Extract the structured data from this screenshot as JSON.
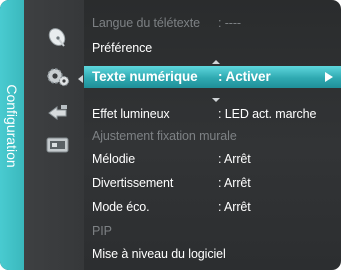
{
  "sidebar": {
    "tab_label": "Configuration"
  },
  "categories": [
    {
      "icon": "satellite-dish-icon"
    },
    {
      "icon": "gears-icon"
    },
    {
      "icon": "input-arrow-icon"
    },
    {
      "icon": "application-icon"
    }
  ],
  "menu": {
    "items": [
      {
        "label": "Langue du télétexte",
        "value": ": ----"
      },
      {
        "label": "Préférence",
        "value": ""
      },
      {
        "label": "Texte numérique",
        "value": ": Activer"
      },
      {
        "label": "Effet lumineux",
        "value": ": LED act. marche"
      },
      {
        "label": "Ajustement fixation murale",
        "value": ""
      },
      {
        "label": "Mélodie",
        "value": ": Arrêt"
      },
      {
        "label": "Divertissement",
        "value": ": Arrêt"
      },
      {
        "label": "Mode éco.",
        "value": ": Arrêt"
      },
      {
        "label": "PIP",
        "value": ""
      },
      {
        "label": "Mise à niveau du logiciel",
        "value": ""
      }
    ]
  },
  "colors": {
    "accent": "#3ab8bd",
    "selected_row": "#2fa9b1",
    "panel_bg": "#2c2e30",
    "disabled_text": "#7d8184"
  }
}
